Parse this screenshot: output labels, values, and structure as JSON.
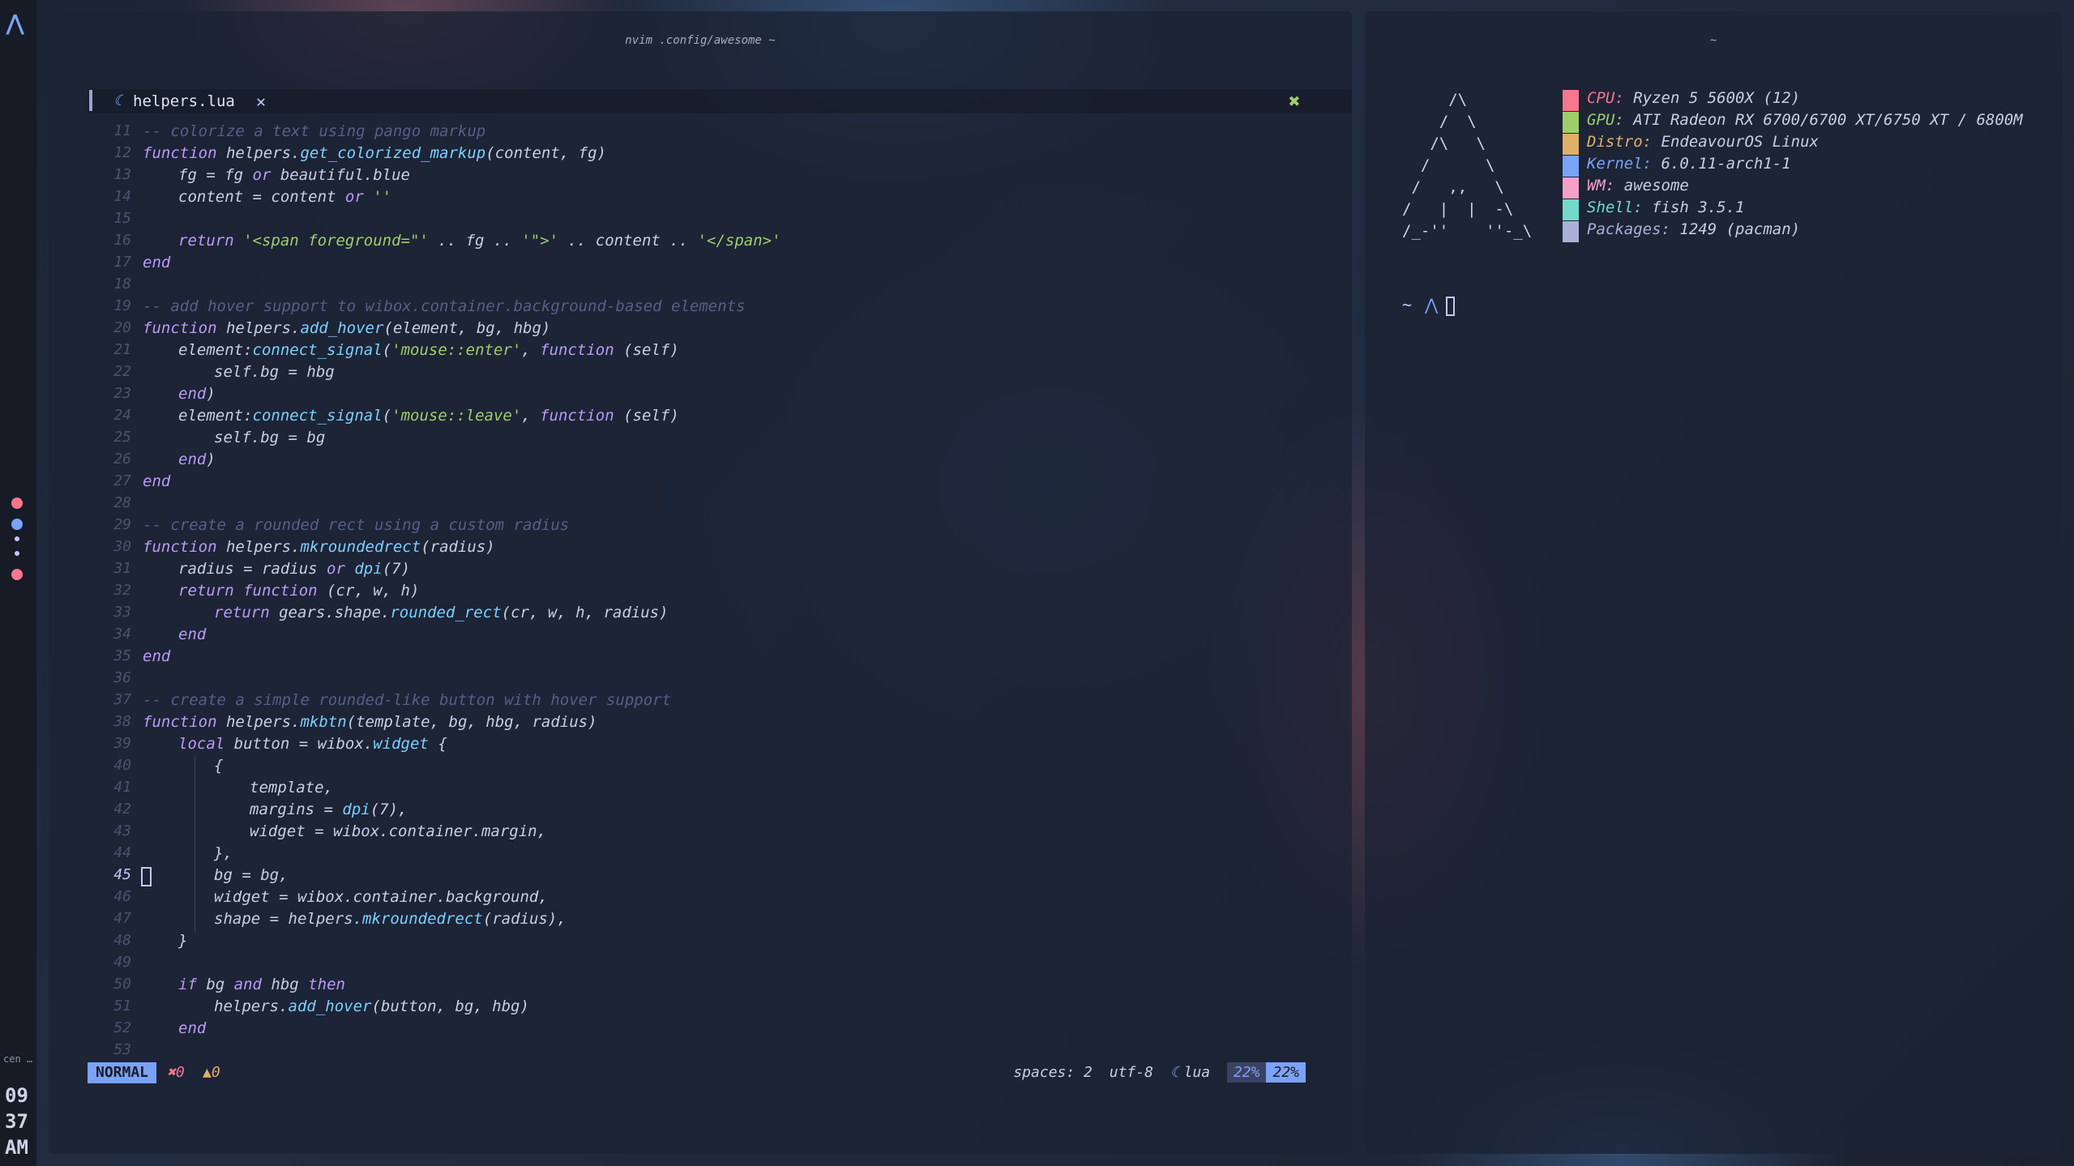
{
  "bar": {
    "logo": "⋀",
    "dots": [
      "#f7768e",
      "#7aa2f7",
      "#c0caf5",
      "#c0caf5",
      "#f7768e"
    ],
    "mini_label": "cen …",
    "clock": {
      "hour": "09",
      "minute": "37",
      "ampm": "AM"
    }
  },
  "editor": {
    "window_title": "nvim .config/awesome ~",
    "tab": {
      "icon": "lua-icon",
      "name": "helpers.lua",
      "close": "✕"
    },
    "close_glyph": "✖",
    "current_line": "45",
    "lines": [
      {
        "n": "11",
        "indent": 0,
        "parts": [
          {
            "c": "com",
            "t": "-- colorize a text using pango markup"
          }
        ]
      },
      {
        "n": "12",
        "indent": 0,
        "parts": [
          {
            "c": "kw",
            "t": "function "
          },
          {
            "c": "",
            "t": "helpers."
          },
          {
            "c": "fn",
            "t": "get_colorized_markup"
          },
          {
            "c": "",
            "t": "(content, fg)"
          }
        ]
      },
      {
        "n": "13",
        "indent": 1,
        "parts": [
          {
            "c": "",
            "t": "fg = fg "
          },
          {
            "c": "kw",
            "t": "or "
          },
          {
            "c": "",
            "t": "beautiful.blue"
          }
        ]
      },
      {
        "n": "14",
        "indent": 1,
        "parts": [
          {
            "c": "",
            "t": "content = content "
          },
          {
            "c": "kw",
            "t": "or "
          },
          {
            "c": "str",
            "t": "''"
          }
        ]
      },
      {
        "n": "15",
        "indent": 0,
        "parts": []
      },
      {
        "n": "16",
        "indent": 1,
        "parts": [
          {
            "c": "kw",
            "t": "return "
          },
          {
            "c": "str",
            "t": "'<span foreground=\"'"
          },
          {
            "c": "",
            " t": ""
          },
          {
            "c": "",
            "t": " .. fg .. "
          },
          {
            "c": "str",
            "t": "'\">'"
          },
          {
            "c": "",
            "t": " .. content .. "
          },
          {
            "c": "str",
            "t": "'</span>'"
          }
        ]
      },
      {
        "n": "17",
        "indent": 0,
        "parts": [
          {
            "c": "kw",
            "t": "end"
          }
        ]
      },
      {
        "n": "18",
        "indent": 0,
        "parts": []
      },
      {
        "n": "19",
        "indent": 0,
        "parts": [
          {
            "c": "com",
            "t": "-- add hover support to wibox.container.background-based elements"
          }
        ]
      },
      {
        "n": "20",
        "indent": 0,
        "parts": [
          {
            "c": "kw",
            "t": "function "
          },
          {
            "c": "",
            "t": "helpers."
          },
          {
            "c": "fn",
            "t": "add_hover"
          },
          {
            "c": "",
            "t": "(element, bg, hbg)"
          }
        ]
      },
      {
        "n": "21",
        "indent": 1,
        "parts": [
          {
            "c": "",
            "t": "element:"
          },
          {
            "c": "fn",
            "t": "connect_signal"
          },
          {
            "c": "",
            "t": "("
          },
          {
            "c": "str",
            "t": "'mouse::enter'"
          },
          {
            "c": "",
            "t": ", "
          },
          {
            "c": "kw",
            "t": "function "
          },
          {
            "c": "",
            "t": "(self)"
          }
        ]
      },
      {
        "n": "22",
        "indent": 2,
        "parts": [
          {
            "c": "",
            "t": "self.bg = hbg"
          }
        ]
      },
      {
        "n": "23",
        "indent": 1,
        "parts": [
          {
            "c": "kw",
            "t": "end"
          },
          {
            "c": "",
            "t": ")"
          }
        ]
      },
      {
        "n": "24",
        "indent": 1,
        "parts": [
          {
            "c": "",
            "t": "element:"
          },
          {
            "c": "fn",
            "t": "connect_signal"
          },
          {
            "c": "",
            "t": "("
          },
          {
            "c": "str",
            "t": "'mouse::leave'"
          },
          {
            "c": "",
            "t": ", "
          },
          {
            "c": "kw",
            "t": "function "
          },
          {
            "c": "",
            "t": "(self)"
          }
        ]
      },
      {
        "n": "25",
        "indent": 2,
        "parts": [
          {
            "c": "",
            "t": "self.bg = bg"
          }
        ]
      },
      {
        "n": "26",
        "indent": 1,
        "parts": [
          {
            "c": "kw",
            "t": "end"
          },
          {
            "c": "",
            "t": ")"
          }
        ]
      },
      {
        "n": "27",
        "indent": 0,
        "parts": [
          {
            "c": "kw",
            "t": "end"
          }
        ]
      },
      {
        "n": "28",
        "indent": 0,
        "parts": []
      },
      {
        "n": "29",
        "indent": 0,
        "parts": [
          {
            "c": "com",
            "t": "-- create a rounded rect using a custom radius"
          }
        ]
      },
      {
        "n": "30",
        "indent": 0,
        "parts": [
          {
            "c": "kw",
            "t": "function "
          },
          {
            "c": "",
            "t": "helpers."
          },
          {
            "c": "fn",
            "t": "mkroundedrect"
          },
          {
            "c": "",
            "t": "(radius)"
          }
        ]
      },
      {
        "n": "31",
        "indent": 1,
        "parts": [
          {
            "c": "",
            "t": "radius = radius "
          },
          {
            "c": "kw",
            "t": "or "
          },
          {
            "c": "fn",
            "t": "dpi"
          },
          {
            "c": "",
            "t": "(7)"
          }
        ]
      },
      {
        "n": "32",
        "indent": 1,
        "parts": [
          {
            "c": "kw",
            "t": "return function "
          },
          {
            "c": "",
            "t": "(cr, w, h)"
          }
        ]
      },
      {
        "n": "33",
        "indent": 2,
        "parts": [
          {
            "c": "kw",
            "t": "return "
          },
          {
            "c": "",
            "t": "gears.shape."
          },
          {
            "c": "fn",
            "t": "rounded_rect"
          },
          {
            "c": "",
            "t": "(cr, w, h, radius)"
          }
        ]
      },
      {
        "n": "34",
        "indent": 1,
        "parts": [
          {
            "c": "kw",
            "t": "end"
          }
        ]
      },
      {
        "n": "35",
        "indent": 0,
        "parts": [
          {
            "c": "kw",
            "t": "end"
          }
        ]
      },
      {
        "n": "36",
        "indent": 0,
        "parts": []
      },
      {
        "n": "37",
        "indent": 0,
        "parts": [
          {
            "c": "com",
            "t": "-- create a simple rounded-like button with hover support"
          }
        ]
      },
      {
        "n": "38",
        "indent": 0,
        "parts": [
          {
            "c": "kw",
            "t": "function "
          },
          {
            "c": "",
            "t": "helpers."
          },
          {
            "c": "fn",
            "t": "mkbtn"
          },
          {
            "c": "",
            "t": "(template, bg, hbg, radius)"
          }
        ]
      },
      {
        "n": "39",
        "indent": 1,
        "parts": [
          {
            "c": "kw",
            "t": "local "
          },
          {
            "c": "",
            "t": "button = wibox."
          },
          {
            "c": "fn",
            "t": "widget"
          },
          {
            "c": "",
            "t": " {"
          }
        ]
      },
      {
        "n": "40",
        "indent": 2,
        "parts": [
          {
            "c": "",
            "t": "{"
          }
        ]
      },
      {
        "n": "41",
        "indent": 3,
        "parts": [
          {
            "c": "",
            "t": "template,"
          }
        ]
      },
      {
        "n": "42",
        "indent": 3,
        "parts": [
          {
            "c": "",
            "t": "margins = "
          },
          {
            "c": "fn",
            "t": "dpi"
          },
          {
            "c": "",
            "t": "(7),"
          }
        ]
      },
      {
        "n": "43",
        "indent": 3,
        "parts": [
          {
            "c": "",
            "t": "widget = wibox.container.margin,"
          }
        ]
      },
      {
        "n": "44",
        "indent": 2,
        "parts": [
          {
            "c": "",
            "t": "},"
          }
        ]
      },
      {
        "n": "45",
        "indent": 2,
        "parts": [
          {
            "c": "",
            "t": "bg = bg,"
          }
        ]
      },
      {
        "n": "46",
        "indent": 2,
        "parts": [
          {
            "c": "",
            "t": "widget = wibox.container.background,"
          }
        ]
      },
      {
        "n": "47",
        "indent": 2,
        "parts": [
          {
            "c": "",
            "t": "shape = helpers."
          },
          {
            "c": "fn",
            "t": "mkroundedrect"
          },
          {
            "c": "",
            "t": "(radius),"
          }
        ]
      },
      {
        "n": "48",
        "indent": 1,
        "parts": [
          {
            "c": "",
            "t": "}"
          }
        ]
      },
      {
        "n": "49",
        "indent": 0,
        "parts": []
      },
      {
        "n": "50",
        "indent": 1,
        "parts": [
          {
            "c": "kw",
            "t": "if "
          },
          {
            "c": "",
            "t": "bg "
          },
          {
            "c": "kw",
            "t": "and "
          },
          {
            "c": "",
            "t": "hbg "
          },
          {
            "c": "kw",
            "t": "then"
          }
        ]
      },
      {
        "n": "51",
        "indent": 2,
        "parts": [
          {
            "c": "",
            "t": "helpers."
          },
          {
            "c": "fn",
            "t": "add_hover"
          },
          {
            "c": "",
            "t": "(button, bg, hbg)"
          }
        ]
      },
      {
        "n": "52",
        "indent": 1,
        "parts": [
          {
            "c": "kw",
            "t": "end"
          }
        ]
      },
      {
        "n": "53",
        "indent": 0,
        "parts": []
      }
    ],
    "status": {
      "mode": "NORMAL",
      "errors": "✖0",
      "warnings": "▲0",
      "spaces": "spaces: 2",
      "encoding": "utf-8",
      "filetype_icon": "lua-icon",
      "filetype": "lua",
      "percent_a": "22%",
      "percent_b": "22%"
    }
  },
  "terminal": {
    "window_title": "~",
    "ascii_logo": "     /\\\n    /  \\\n   /\\   \\\n  /      \\\n /   ,,   \\\n/   |  |  -\\\n/_-''    ''-_\\",
    "info": [
      {
        "key": "CPU:",
        "value": " Ryzen 5 5600X (12)",
        "color": "#f7768e"
      },
      {
        "key": "GPU:",
        "value": " ATI Radeon RX 6700/6700 XT/6750 XT / 6800M",
        "color": "#9ece6a"
      },
      {
        "key": "Distro:",
        "value": " EndeavourOS Linux",
        "color": "#e0af68"
      },
      {
        "key": "Kernel:",
        "value": " 6.0.11-arch1-1",
        "color": "#7aa2f7"
      },
      {
        "key": "WM:",
        "value": " awesome",
        "color": "#f5a0c8"
      },
      {
        "key": "Shell:",
        "value": " fish 3.5.1",
        "color": "#73daca"
      },
      {
        "key": "Packages:",
        "value": " 1249 (pacman)",
        "color": "#a9b1d6"
      }
    ],
    "prompt": {
      "cwd": "~",
      "symbol": "⋀"
    }
  }
}
